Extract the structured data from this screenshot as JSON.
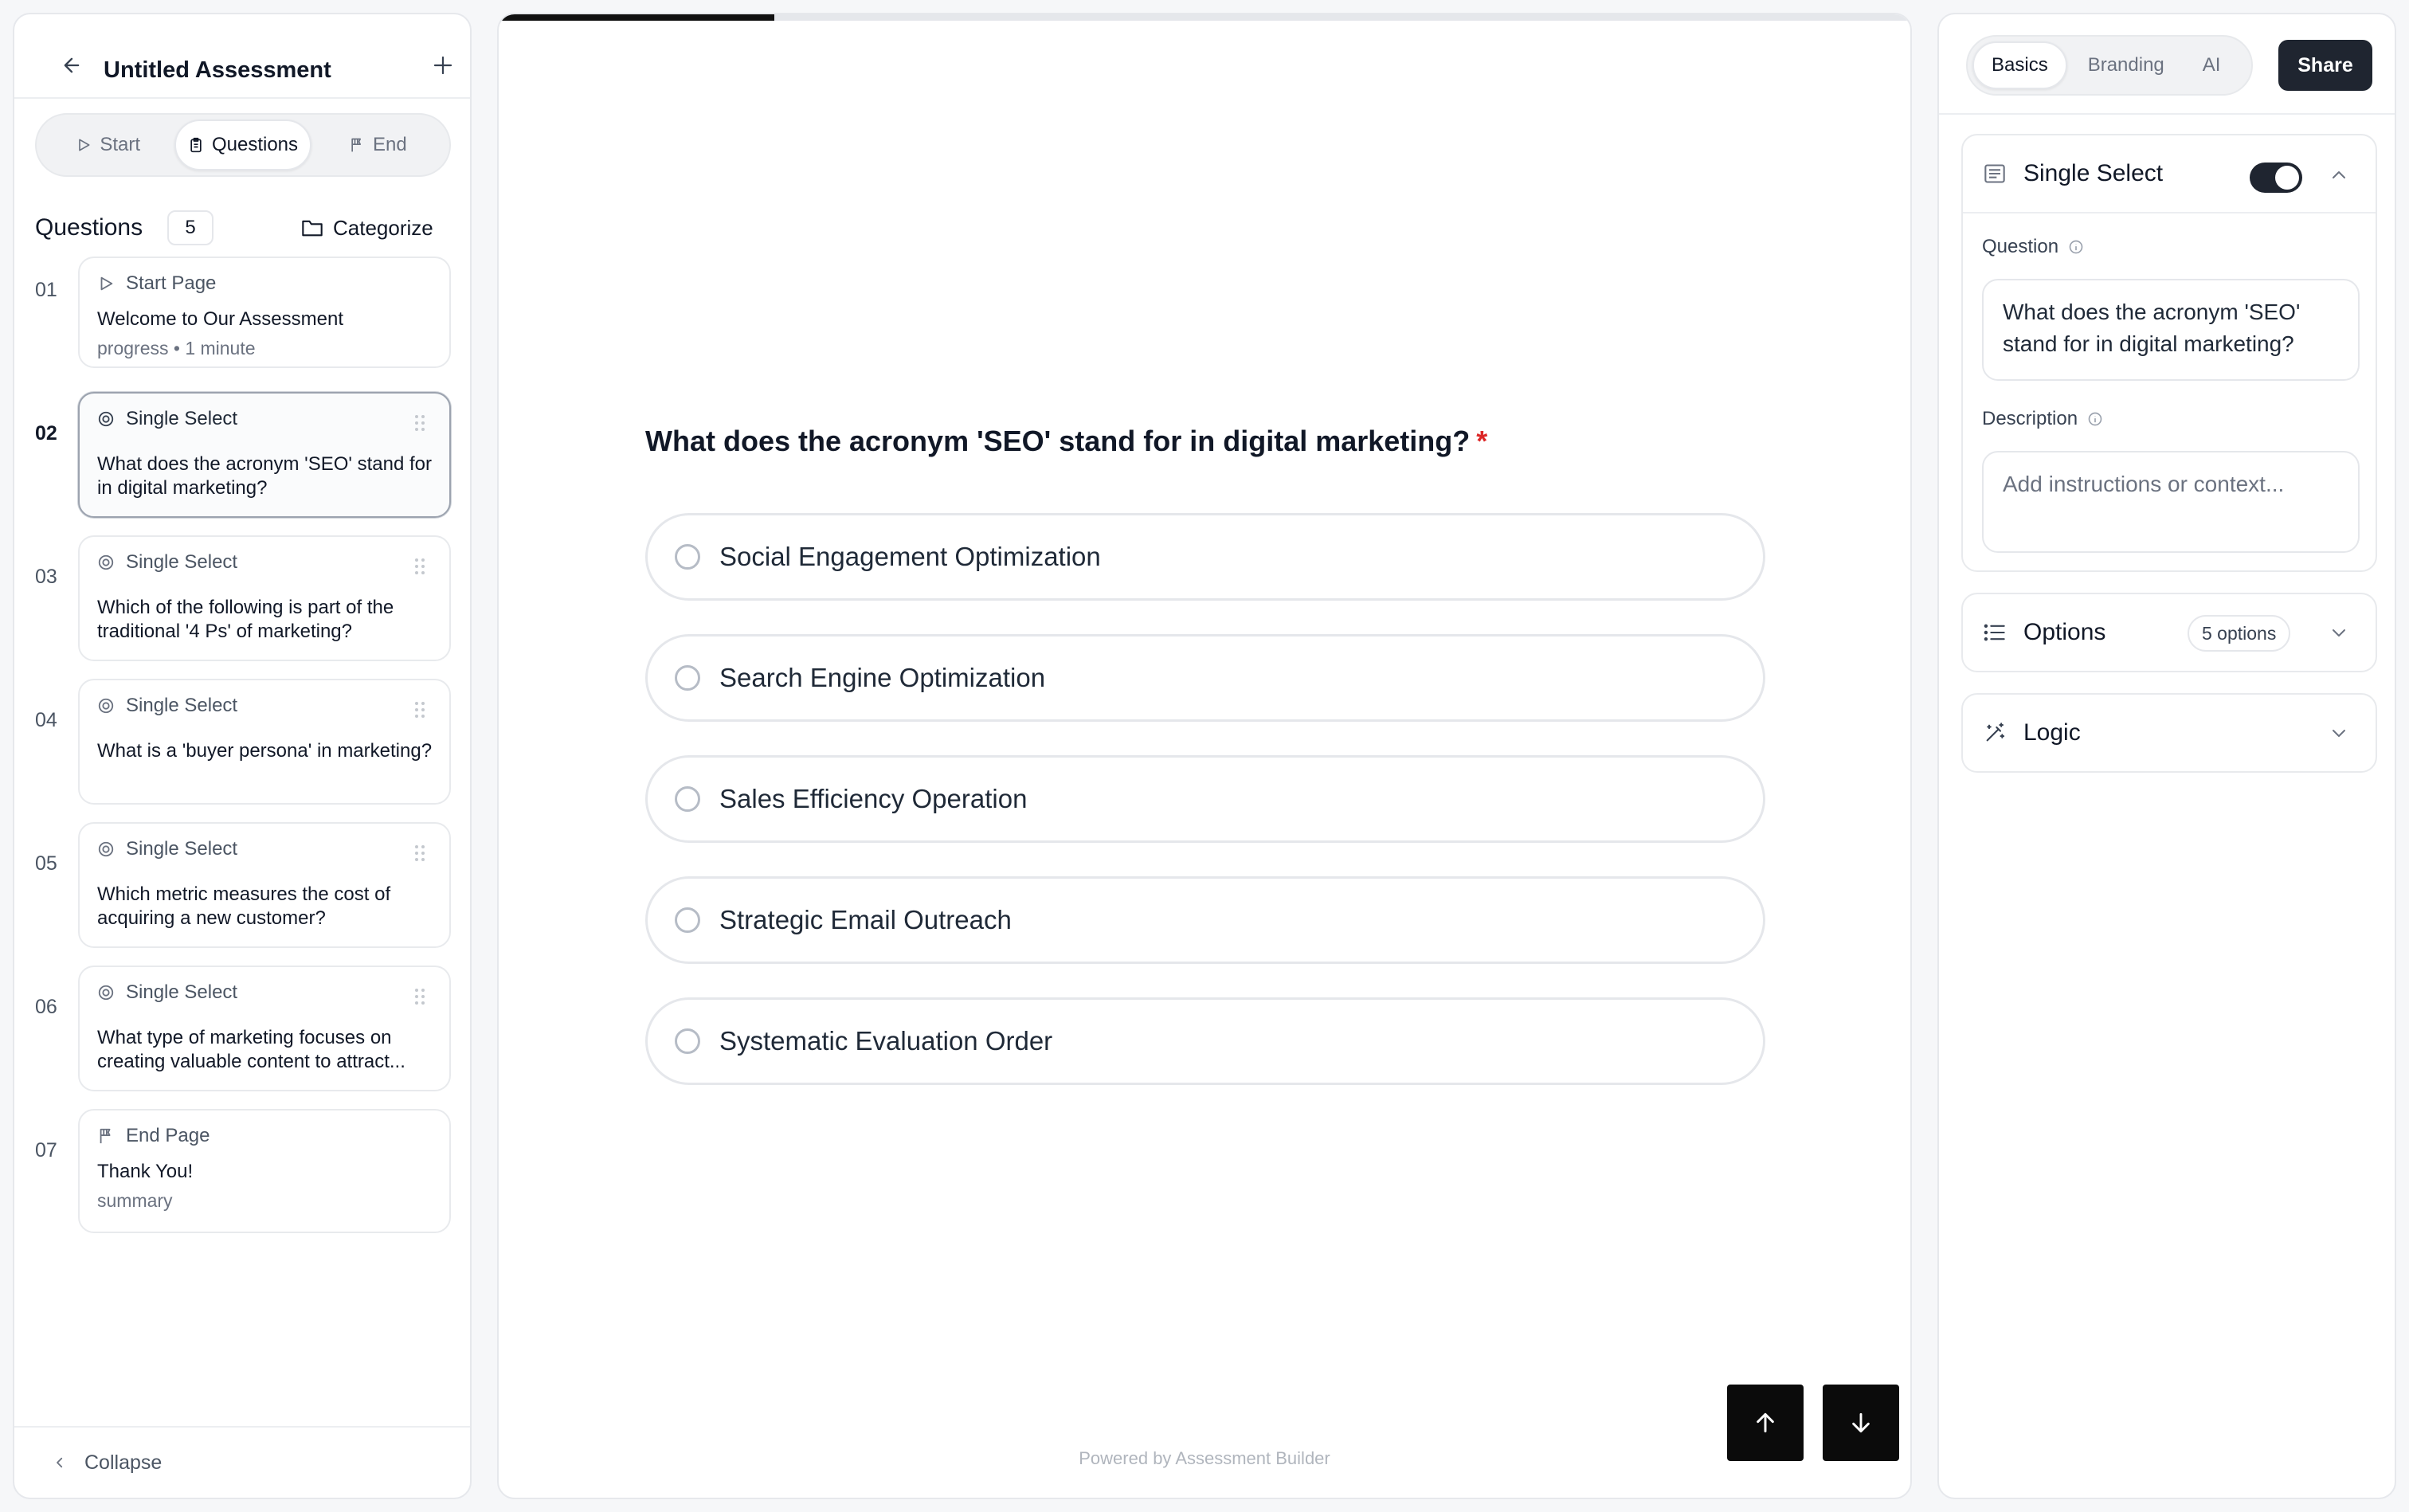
{
  "sidebar": {
    "title": "Untitled Assessment",
    "tabs": [
      {
        "label": "Start",
        "icon": "play-icon"
      },
      {
        "label": "Questions",
        "icon": "clipboard-icon",
        "active": true
      },
      {
        "label": "End",
        "icon": "flag-icon"
      }
    ],
    "questions_label": "Questions",
    "questions_count": "5",
    "categorize_label": "Categorize",
    "items": [
      {
        "num": "01",
        "type": "Start Page",
        "text": "Welcome to Our Assessment",
        "sub": "progress • 1 minute"
      },
      {
        "num": "02",
        "type": "Single Select",
        "text": "What does the acronym 'SEO' stand for in digital marketing?",
        "active": true
      },
      {
        "num": "03",
        "type": "Single Select",
        "text": "Which of the following is part of the traditional '4 Ps' of marketing?"
      },
      {
        "num": "04",
        "type": "Single Select",
        "text": "What is a 'buyer persona' in marketing?"
      },
      {
        "num": "05",
        "type": "Single Select",
        "text": "Which metric measures the cost of acquiring a new customer?"
      },
      {
        "num": "06",
        "type": "Single Select",
        "text": "What type of marketing focuses on creating valuable content to attract..."
      },
      {
        "num": "07",
        "type": "End Page",
        "text": "Thank You!",
        "sub": "summary"
      }
    ],
    "collapse_label": "Collapse"
  },
  "preview": {
    "progress_fraction": 0.195,
    "question": "What does the acronym 'SEO' stand for in digital marketing?",
    "required_mark": "*",
    "options": [
      "Social Engagement Optimization",
      "Search Engine Optimization",
      "Sales Efficiency Operation",
      "Strategic Email Outreach",
      "Systematic Evaluation Order"
    ],
    "powered_by": "Powered by Assessment Builder"
  },
  "right_panel": {
    "tabs": [
      "Basics",
      "Branding",
      "AI"
    ],
    "active_tab": "Basics",
    "share_label": "Share",
    "block": {
      "title": "Single Select",
      "enabled": true,
      "question_label": "Question",
      "question_value": "What does the acronym 'SEO' stand for in digital marketing?",
      "description_label": "Description",
      "description_placeholder": "Add instructions or context..."
    },
    "options_section": {
      "label": "Options",
      "badge": "5 options"
    },
    "logic_section": {
      "label": "Logic"
    }
  },
  "colors": {
    "accent_dark": "#1f2530",
    "required": "#dc2626",
    "border": "#e5e7eb"
  }
}
